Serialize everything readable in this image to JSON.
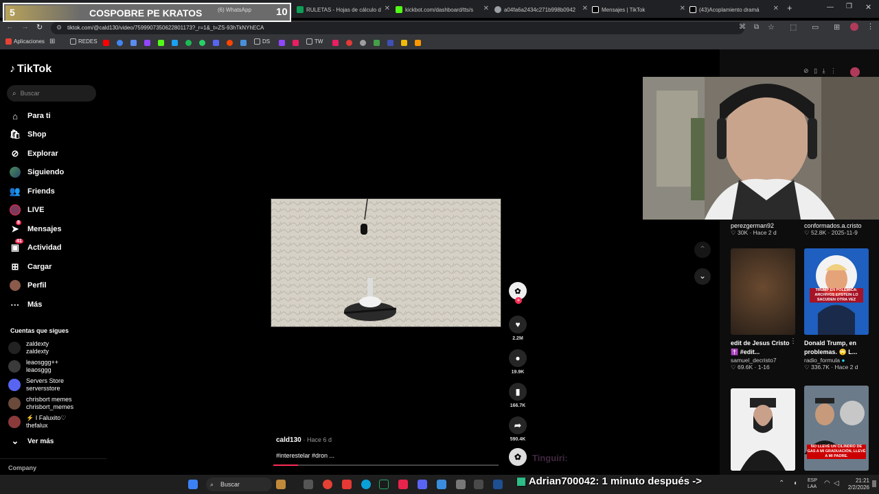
{
  "browser": {
    "tabs": [
      {
        "title": "(6) WhatsApp",
        "color": "#25d366"
      },
      {
        "title": "RULETAS - Hojas de cálculo d",
        "color": "#0f9d58"
      },
      {
        "title": "kickbot.com/dashboard/tts/s",
        "color": "#53fc18"
      },
      {
        "title": "a04fa6a2434c271b998b0942",
        "color": "#9aa0a6"
      },
      {
        "title": "Mensajes | TikTok",
        "color": "#ffffff"
      },
      {
        "title": "(43)Acoplamiento dramá",
        "color": "#ffffff"
      }
    ],
    "url": "tiktok.com/@cald130/video/7599907350622801173?_r=1&_t=ZS-93hTkNYhECA",
    "bookmarks": [
      "Aplicaciones",
      "REDES",
      "DS",
      "TW"
    ]
  },
  "stream_overlay": {
    "left_number": "5",
    "title": "COSPOBRE PE KRATOS",
    "right_number": "10"
  },
  "tiktok": {
    "logo": "TikTok",
    "search_placeholder": "Buscar",
    "nav": [
      "Para ti",
      "Shop",
      "Explorar",
      "Siguiendo",
      "Friends",
      "LIVE",
      "Mensajes",
      "Actividad",
      "Cargar",
      "Perfil",
      "Más"
    ],
    "badges": {
      "mensajes": "8",
      "actividad": "41"
    },
    "following_title": "Cuentas que sigues",
    "following": [
      {
        "name": "zaldexty",
        "handle": "zaldexty"
      },
      {
        "name": "leaosggg++",
        "handle": "leaosggg"
      },
      {
        "name": "Servers Store",
        "handle": "serversstore"
      },
      {
        "name": "chrisbort memes",
        "handle": "chrisbort_memes"
      },
      {
        "name": "⚡ I Faluxito♡",
        "handle": "thefalux"
      }
    ],
    "see_more": "Ver más",
    "company": "Company",
    "video": {
      "author": "cald130",
      "time": "Hace 6 d",
      "caption": "#interestelar #dron ..."
    },
    "actions": {
      "likes": "2.2M",
      "comments": "19.9K",
      "saves": "166.7K",
      "shares": "590.4K"
    },
    "suggested": [
      {
        "user": "perezgerman92",
        "stats": "30K · Hace 2 d"
      },
      {
        "user": "conformados.a.cristo",
        "stats": "52.8K · 2025-11-9"
      },
      {
        "title": "edit de Jesus Cristo ✝️ #edit...",
        "user": "samuel_decristo7",
        "stats": "69.6K · 1-16"
      },
      {
        "title": "Donald Trump, en problemas. 🙄 L...",
        "user": "radio_formula",
        "stats": "336.7K · Hace 2 d",
        "thumb_text": "TRUMP EN POLÉMICA: ARCHIVOS EPSTEIN LO SACUDEN OTRA VEZ"
      },
      {
        "thumb_text": "NO LLEVÉ UN CILINDRO DE GAS A MI GRADUACIÓN, LLEVÉ A MI PADRE."
      }
    ]
  },
  "chat_overlay": {
    "line1_user": "Tinguiri:",
    "line2": "Adrian700042: 1 minuto después ->"
  },
  "taskbar": {
    "search": "Buscar",
    "lang": "ESP\nLAA",
    "time": "21:21",
    "date": "2/2/2026"
  }
}
